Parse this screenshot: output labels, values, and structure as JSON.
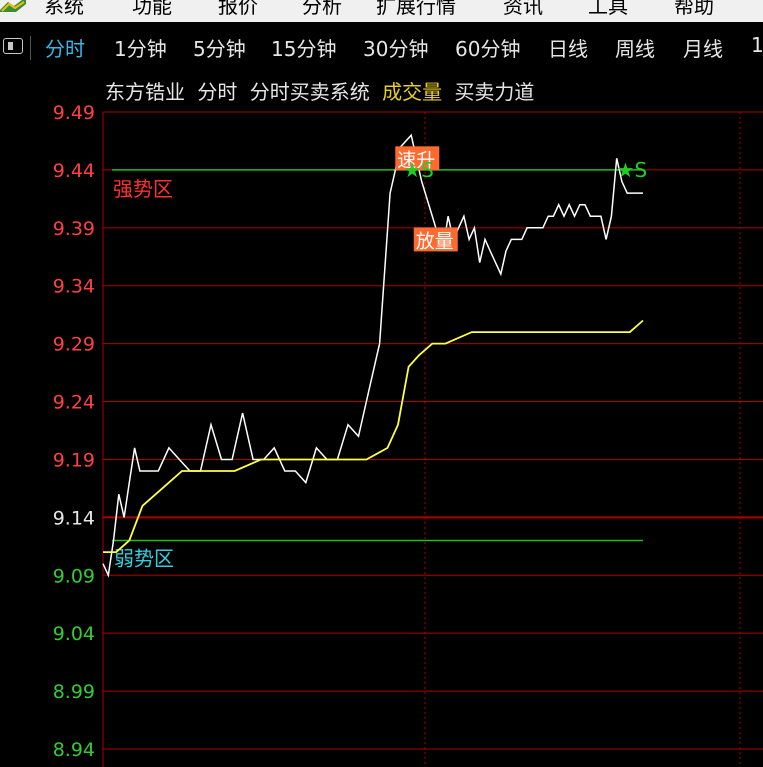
{
  "menu": [
    "系统",
    "功能",
    "报价",
    "分析",
    "扩展行情",
    "资讯",
    "工具",
    "帮助"
  ],
  "tabs": [
    "分时",
    "1分钟",
    "5分钟",
    "15分钟",
    "30分钟",
    "60分钟",
    "日线",
    "周线",
    "月线",
    "1"
  ],
  "active_tab": "分时",
  "indicator": {
    "stock": "东方锆业",
    "mode": "分时",
    "system": "分时买卖系统",
    "volume": "成交量",
    "force": "买卖力道"
  },
  "colors": {
    "up": "#ff4040",
    "down": "#33cc33",
    "price_line": "#ffffff",
    "avg_line": "#ffff40",
    "grid": "#b00000",
    "tab_active": "#38b6e8",
    "zone_line": "#20c020"
  },
  "chart_data": {
    "type": "line",
    "title": "",
    "xlabel": "",
    "ylabel": "",
    "pre_close": 9.14,
    "ylim": [
      8.94,
      9.49
    ],
    "y_ticks": [
      9.49,
      9.44,
      9.39,
      9.34,
      9.29,
      9.24,
      9.19,
      9.14,
      9.09,
      9.04,
      8.99,
      8.94
    ],
    "x_points": 134,
    "series": [
      {
        "role": "price",
        "x": [
          0,
          2,
          4,
          6,
          8,
          10,
          12,
          14,
          17,
          21,
          25,
          29,
          33,
          37,
          41,
          45,
          49,
          53,
          57,
          61,
          65,
          69,
          73,
          77,
          81,
          85,
          89,
          93,
          97,
          101,
          105,
          109,
          113,
          117,
          121,
          125,
          129,
          131,
          133,
          135,
          137,
          139,
          141,
          143,
          145,
          147,
          149,
          151,
          153,
          155,
          157,
          159,
          161,
          163,
          165,
          167,
          169,
          171,
          173,
          175,
          177,
          179,
          181,
          183,
          185,
          187,
          189,
          191,
          193,
          195,
          197,
          199,
          201,
          203,
          205
        ],
        "values": [
          9.1,
          9.09,
          9.12,
          9.16,
          9.14,
          9.17,
          9.2,
          9.18,
          9.18,
          9.18,
          9.2,
          9.19,
          9.18,
          9.18,
          9.22,
          9.19,
          9.19,
          9.23,
          9.19,
          9.19,
          9.2,
          9.18,
          9.18,
          9.17,
          9.2,
          9.19,
          9.19,
          9.22,
          9.21,
          9.25,
          9.29,
          9.42,
          9.46,
          9.47,
          9.43,
          9.4,
          9.37,
          9.4,
          9.38,
          9.39,
          9.4,
          9.38,
          9.39,
          9.36,
          9.38,
          9.37,
          9.36,
          9.35,
          9.37,
          9.38,
          9.38,
          9.38,
          9.39,
          9.39,
          9.39,
          9.39,
          9.4,
          9.4,
          9.41,
          9.4,
          9.41,
          9.4,
          9.41,
          9.41,
          9.4,
          9.4,
          9.4,
          9.38,
          9.4,
          9.45,
          9.43,
          9.42,
          9.42,
          9.42,
          9.42
        ]
      },
      {
        "role": "average",
        "x": [
          0,
          5,
          10,
          15,
          20,
          25,
          30,
          35,
          40,
          50,
          60,
          70,
          80,
          90,
          100,
          108,
          112,
          116,
          120,
          125,
          130,
          140,
          150,
          160,
          170,
          180,
          190,
          200,
          205
        ],
        "values": [
          9.11,
          9.11,
          9.12,
          9.15,
          9.16,
          9.17,
          9.18,
          9.18,
          9.18,
          9.18,
          9.19,
          9.19,
          9.19,
          9.19,
          9.19,
          9.2,
          9.22,
          9.27,
          9.28,
          9.29,
          9.29,
          9.3,
          9.3,
          9.3,
          9.3,
          9.3,
          9.3,
          9.3,
          9.31
        ]
      }
    ],
    "x_max": 205,
    "zones": [
      {
        "label": "强势区",
        "value": 9.44
      },
      {
        "label": "弱势区",
        "value": 9.12
      }
    ],
    "markers": [
      {
        "label": "速升",
        "x": 114,
        "value": 9.45
      },
      {
        "label": "放量",
        "x": 121,
        "value": 9.38
      },
      {
        "label": "★S",
        "x": 117,
        "value": 9.44
      },
      {
        "label": "★S",
        "x": 198,
        "value": 9.44
      }
    ]
  }
}
